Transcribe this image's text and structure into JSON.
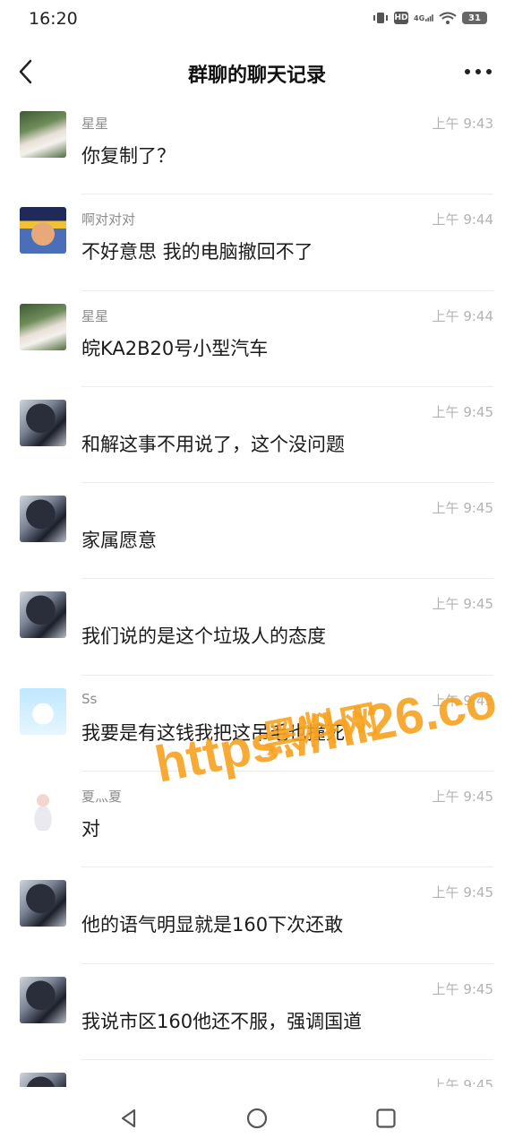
{
  "status_bar": {
    "time": "16:20",
    "icons": [
      "vibrate-icon",
      "hd-icon",
      "signal-4g-icon",
      "wifi-icon",
      "battery-icon"
    ],
    "hd_label": "HD",
    "network_label": "4G",
    "battery_level": "31"
  },
  "header": {
    "title": "群聊的聊天记录",
    "back_icon": "chevron-left-icon",
    "more_icon": "more-dots-icon"
  },
  "messages": [
    {
      "sender": "星星",
      "time": "上午 9:43",
      "text": "你复制了？"
    },
    {
      "sender": "啊对对对",
      "time": "上午 9:44",
      "text": "不好意思 我的电脑撤回不了"
    },
    {
      "sender": "星星",
      "time": "上午 9:44",
      "text": "皖KA2B20号小型汽车"
    },
    {
      "sender": "",
      "time": "上午 9:45",
      "text": "和解这事不用说了，这个没问题"
    },
    {
      "sender": "",
      "time": "上午 9:45",
      "text": "家属愿意"
    },
    {
      "sender": "",
      "time": "上午 9:45",
      "text": "我们说的是这个垃圾人的态度"
    },
    {
      "sender": "Ss",
      "time": "上午 9:45",
      "text": "我要是有这钱我把这吊毛也撞死"
    },
    {
      "sender": "夏灬夏",
      "time": "上午 9:45",
      "text": "对"
    },
    {
      "sender": "",
      "time": "上午 9:45",
      "text": "他的语气明显就是160下次还敢"
    },
    {
      "sender": "",
      "time": "上午 9:45",
      "text": "我说市区160他还不服，强调国道"
    },
    {
      "sender": "",
      "time": "上午 9:45",
      "text": ""
    }
  ],
  "watermark": {
    "site_name": "黑料网",
    "url": "https://hl26.co"
  },
  "nav_bar": {
    "icons": [
      "triangle-back-icon",
      "circle-home-icon",
      "square-recents-icon"
    ]
  },
  "colors": {
    "watermark": "#f7a21e",
    "time_text": "#b3b3b3",
    "sender_text": "#8c8c8c"
  }
}
